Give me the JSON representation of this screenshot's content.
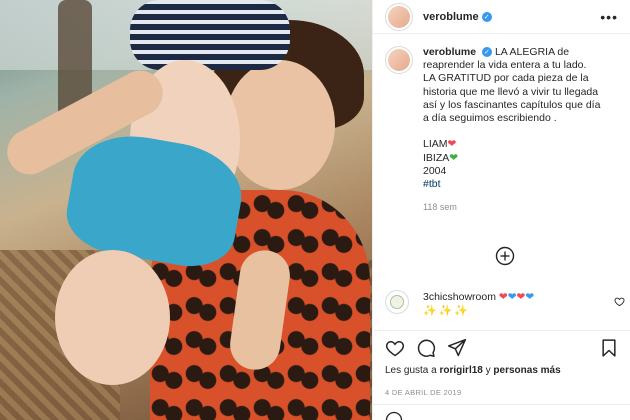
{
  "post": {
    "username": "veroblume",
    "verified_icon": "verified-badge-icon",
    "more_icon": "more-options-icon"
  },
  "caption": {
    "username": "veroblume",
    "lines": [
      "LA ALEGRIA de",
      "reaprender la vida entera a tu lado.",
      "LA GRATITUD por cada pieza de la",
      "historia que me llevó a vivir tu llegada",
      "así y los fascinantes capítulos que día",
      "a día seguimos escribiendo ."
    ],
    "name_line": "LIAM",
    "place_line": "IBIZA",
    "year_line": "2004",
    "hashtag": "#tbt",
    "time_ago": "118 sem",
    "heart_red": "❤",
    "heart_green": "💚"
  },
  "load_more_icon": "plus-circle-icon",
  "comment": {
    "username": "3chicshowroom",
    "hearts": "❤💙❤💙",
    "sparkles": "✨✨✨",
    "like_icon": "heart-outline-icon"
  },
  "actions": {
    "like_icon": "heart-outline-icon",
    "comment_icon": "comment-icon",
    "share_icon": "share-icon",
    "save_icon": "bookmark-icon"
  },
  "likes": {
    "prefix": "Les gusta a",
    "user": "rorigirl18",
    "connector": "y",
    "others": "personas más"
  },
  "date": "4 DE ABRIL DE 2019",
  "colors": {
    "verified": "#3897f0",
    "heart_red": "#ed4956",
    "heart_blue": "#3897f0",
    "hashtag": "#00376b",
    "muted": "#8e8e8e"
  }
}
